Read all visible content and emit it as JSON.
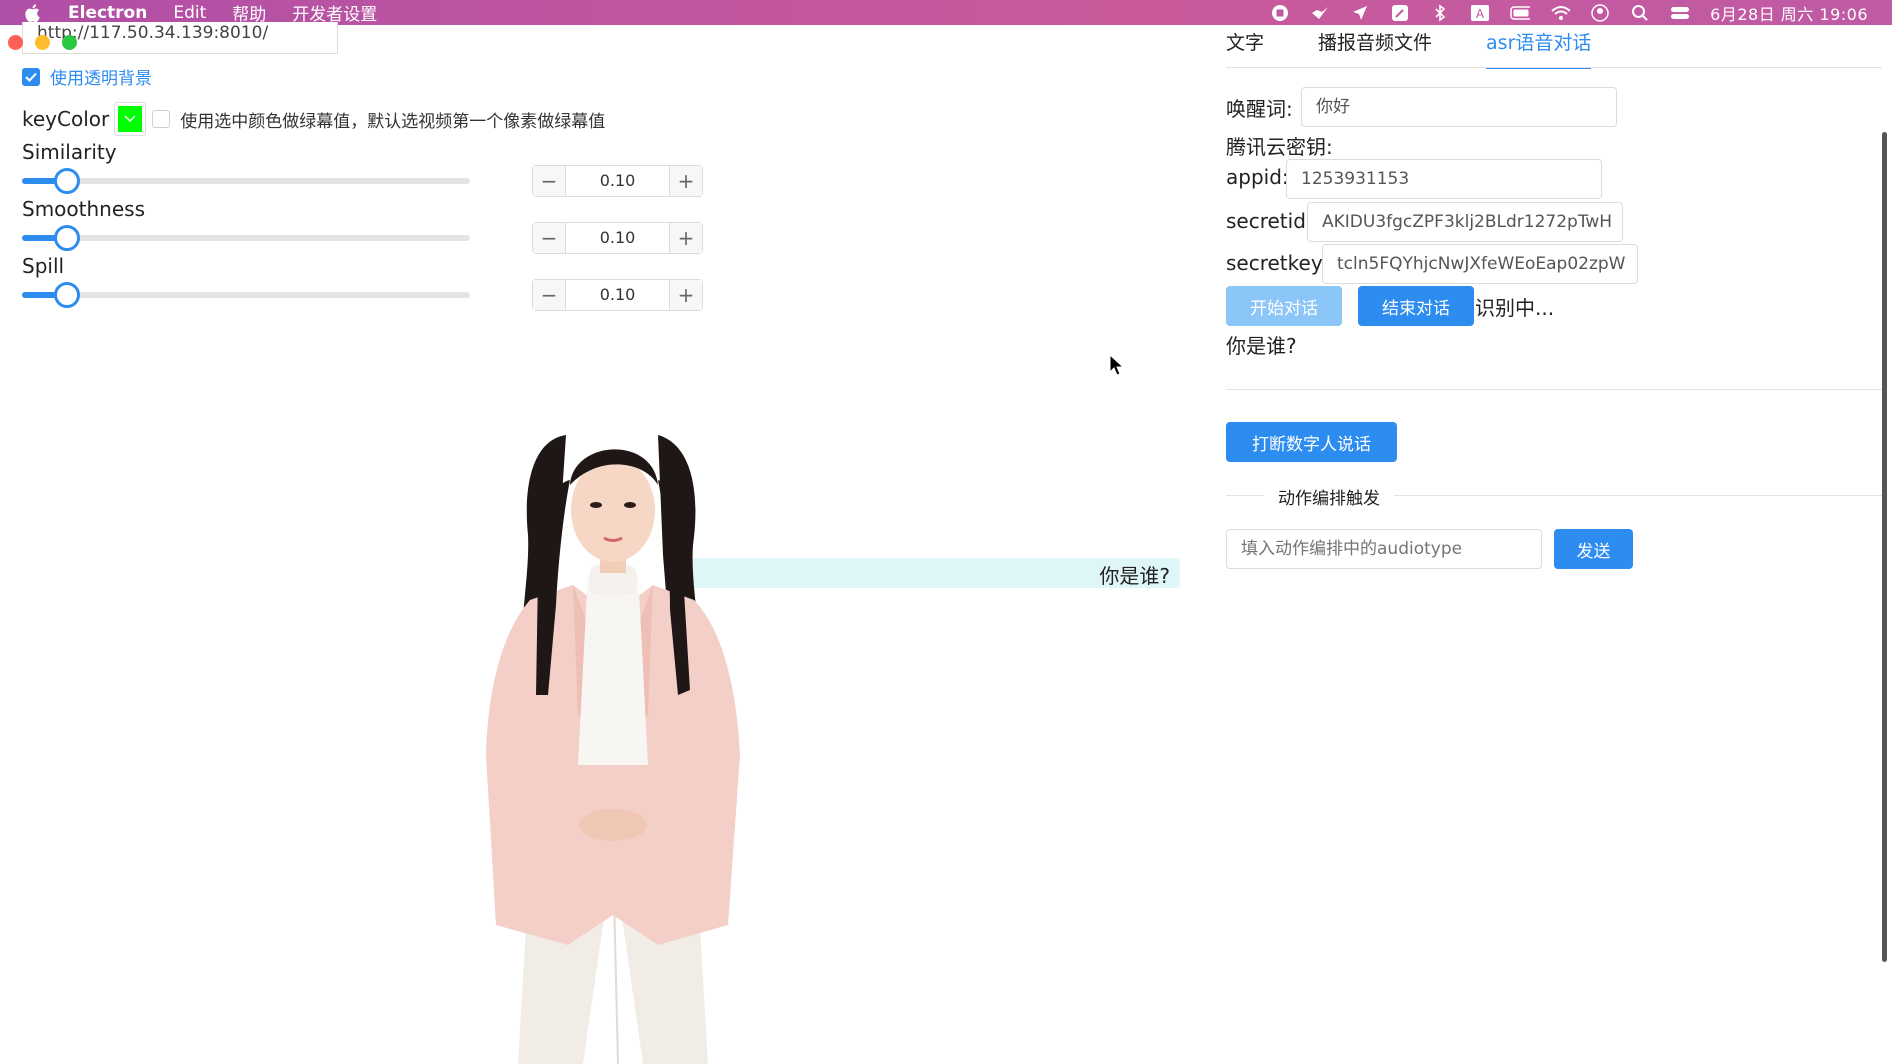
{
  "menubar": {
    "app_name": "Electron",
    "items": [
      "Edit",
      "帮助",
      "开发者设置"
    ],
    "clock": "6月28日 周六  19:06"
  },
  "window": {
    "url": "http://117.50.34.139:8010/"
  },
  "left_panel": {
    "transparent_bg_label": "使用透明背景",
    "key_color_label": "keyColor",
    "key_color_value": "#00ff00",
    "key_color_desc": "使用选中颜色做绿幕值，默认选视频第一个像素做绿幕值",
    "sliders": [
      {
        "label": "Similarity",
        "value": "0.10",
        "level": 0.1
      },
      {
        "label": "Smoothness",
        "value": "0.10",
        "level": 0.1
      },
      {
        "label": "Spill",
        "value": "0.10",
        "level": 0.1
      }
    ]
  },
  "stage": {
    "speech_text": "你是谁?"
  },
  "right_panel": {
    "tabs": [
      {
        "label": "文字",
        "active": false
      },
      {
        "label": "播报音频文件",
        "active": false
      },
      {
        "label": "asr语音对话",
        "active": true
      }
    ],
    "wake_word_label": "唤醒词:",
    "wake_word_value": "你好",
    "tencent_key_label": "腾讯云密钥:",
    "appid_label": "appid:",
    "appid_value": "1253931153",
    "secretid_label": "secretid:",
    "secretid_value": "AKIDU3fgcZPF3klj2BLdr1272pTwH",
    "secretkey_label": "secretkey:",
    "secretkey_value": "tcln5FQYhjcNwJXfeWEoEap02zpW",
    "start_button": "开始对话",
    "end_button": "结束对话",
    "status": "识别中...",
    "recognized_text": "你是谁?",
    "interrupt_button": "打断数字人说话",
    "action_section_title": "动作编排触发",
    "audiotype_placeholder": "填入动作编排中的audiotype",
    "send_button": "发送"
  }
}
